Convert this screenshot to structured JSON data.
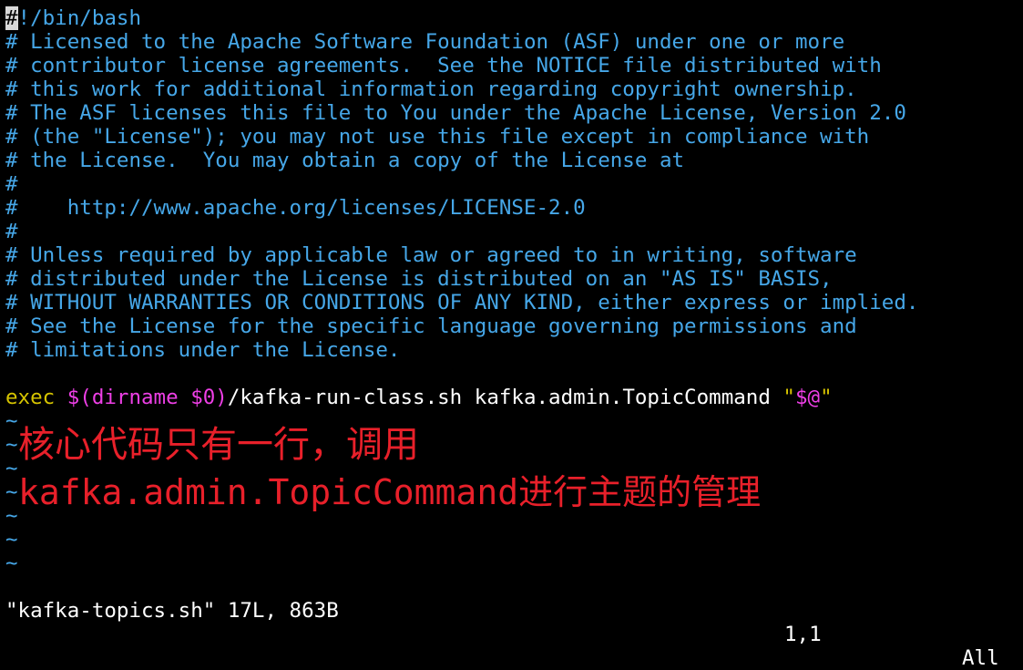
{
  "editor": {
    "cursor_char": "#",
    "shebang_rest": "!/bin/bash",
    "comments": [
      "# Licensed to the Apache Software Foundation (ASF) under one or more",
      "# contributor license agreements.  See the NOTICE file distributed with",
      "# this work for additional information regarding copyright ownership.",
      "# The ASF licenses this file to You under the Apache License, Version 2.0",
      "# (the \"License\"); you may not use this file except in compliance with",
      "# the License.  You may obtain a copy of the License at",
      "#",
      "#    http://www.apache.org/licenses/LICENSE-2.0",
      "#",
      "# Unless required by applicable law or agreed to in writing, software",
      "# distributed under the License is distributed on an \"AS IS\" BASIS,",
      "# WITHOUT WARRANTIES OR CONDITIONS OF ANY KIND, either express or implied.",
      "# See the License for the specific language governing permissions and",
      "# limitations under the License."
    ],
    "blank": "",
    "exec_line": {
      "keyword": "exec",
      "space1": " ",
      "subst": "$(dirname $0)",
      "path": "/kafka-run-class.sh kafka.admin.TopicCommand ",
      "quote_open": "\"",
      "args": "$@",
      "quote_close": "\""
    },
    "tilde": "~"
  },
  "annotation": {
    "line1": "核心代码只有一行，调用",
    "line2": "kafka.admin.TopicCommand进行主题的管理"
  },
  "status": {
    "file": "\"kafka-topics.sh\" 17L, 863B",
    "position": "1,1",
    "scroll": "All"
  }
}
